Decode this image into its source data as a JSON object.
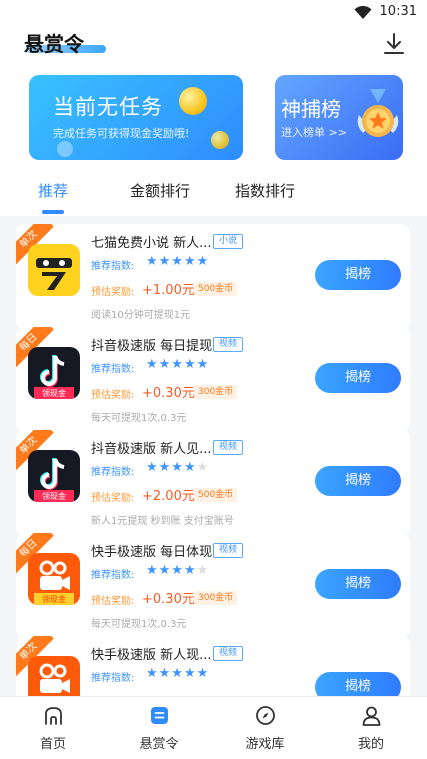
{
  "status_bar": {
    "time": "10:31"
  },
  "header": {
    "title": "悬赏令"
  },
  "banners": {
    "task": {
      "title": "当前无任务",
      "subtitle": "完成任务可获得现金奖励哦!"
    },
    "rank": {
      "title": "神捕榜",
      "subtitle": "进入榜单 >>"
    }
  },
  "tabs": [
    {
      "label": "推荐"
    },
    {
      "label": "金额排行"
    },
    {
      "label": "指数排行"
    }
  ],
  "common": {
    "rec_label": "推荐指数:",
    "reward_label": "预估奖励:",
    "claim_label": "揭榜"
  },
  "tasks": [
    {
      "ribbon": "单次",
      "title": "七猫免费小说 新人...",
      "tag": "小说",
      "stars": 5,
      "reward": "+1.00元",
      "coins": "500金币",
      "desc": "阅读10分钟可提现1元",
      "icon": "qimao-app-icon"
    },
    {
      "ribbon": "每日",
      "title": "抖音极速版 每日提现",
      "tag": "视频",
      "stars": 5,
      "reward": "+0.30元",
      "coins": "300金币",
      "desc": "每天可提现1次,0.3元",
      "icon": "douyin-app-icon",
      "icon_badge": "领现金"
    },
    {
      "ribbon": "单次",
      "title": "抖音极速版 新人见...",
      "tag": "视频",
      "stars": 4,
      "reward": "+2.00元",
      "coins": "500金币",
      "desc": "新人1元提现 秒到账 支付宝账号",
      "icon": "douyin-app-icon",
      "icon_badge": "领现金"
    },
    {
      "ribbon": "每日",
      "title": "快手极速版 每日体现",
      "tag": "视频",
      "stars": 4,
      "reward": "+0.30元",
      "coins": "300金币",
      "desc": "每天可提现1次,0.3元",
      "icon": "kuaishou-app-icon",
      "icon_badge": "领现金"
    },
    {
      "ribbon": "单次",
      "title": "快手极速版 新人现...",
      "tag": "视频",
      "stars": 5,
      "reward": "",
      "coins": "",
      "desc": "",
      "icon": "kuaishou-app-icon"
    }
  ],
  "bottom_nav": [
    {
      "label": "首页",
      "icon": "home-icon"
    },
    {
      "label": "悬赏令",
      "icon": "bounty-icon"
    },
    {
      "label": "游戏库",
      "icon": "compass-icon"
    },
    {
      "label": "我的",
      "icon": "profile-icon"
    }
  ],
  "colors": {
    "accent": "#2f8cff",
    "ribbon": "#ff7a1a",
    "reward": "#ff5a1f"
  }
}
